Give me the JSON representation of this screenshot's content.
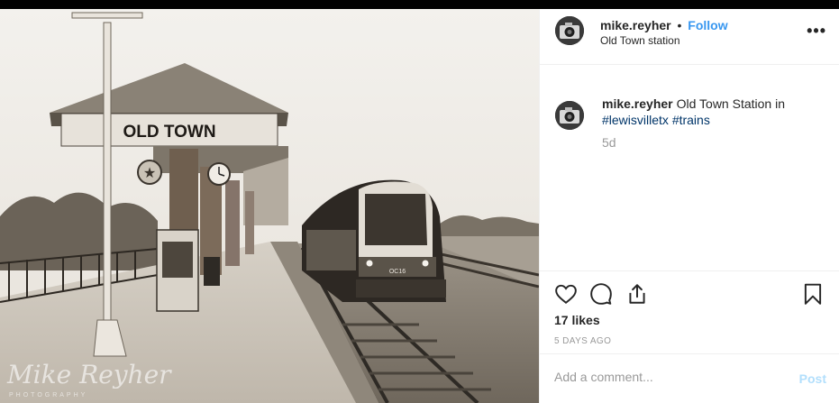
{
  "post": {
    "username": "mike.reyher",
    "separator": "•",
    "follow_label": "Follow",
    "location": "Old Town station",
    "more_icon": "more-options-icon",
    "more_glyph": "•••"
  },
  "photo": {
    "sign_text": "OLD TOWN",
    "train_label": "OC16",
    "watermark": "Mike Reyher",
    "watermark_sub": "PHOTOGRAPHY"
  },
  "caption": {
    "username": "mike.reyher",
    "text": "Old Town Station in",
    "hashtags": [
      "#lewisvilletx",
      "#trains"
    ],
    "time_ago": "5d"
  },
  "actions": {
    "like_icon": "heart-icon",
    "comment_icon": "comment-icon",
    "share_icon": "share-icon",
    "save_icon": "bookmark-icon",
    "likes": "17 likes",
    "date": "5 DAYS AGO"
  },
  "comment_box": {
    "placeholder": "Add a comment...",
    "post_label": "Post"
  },
  "colors": {
    "link_blue": "#3897f0",
    "hashtag": "#003569",
    "muted": "#999999",
    "post_disabled": "#b2dffc",
    "sepia_light": "#ece8e1",
    "sepia_dark": "#3b352e"
  }
}
